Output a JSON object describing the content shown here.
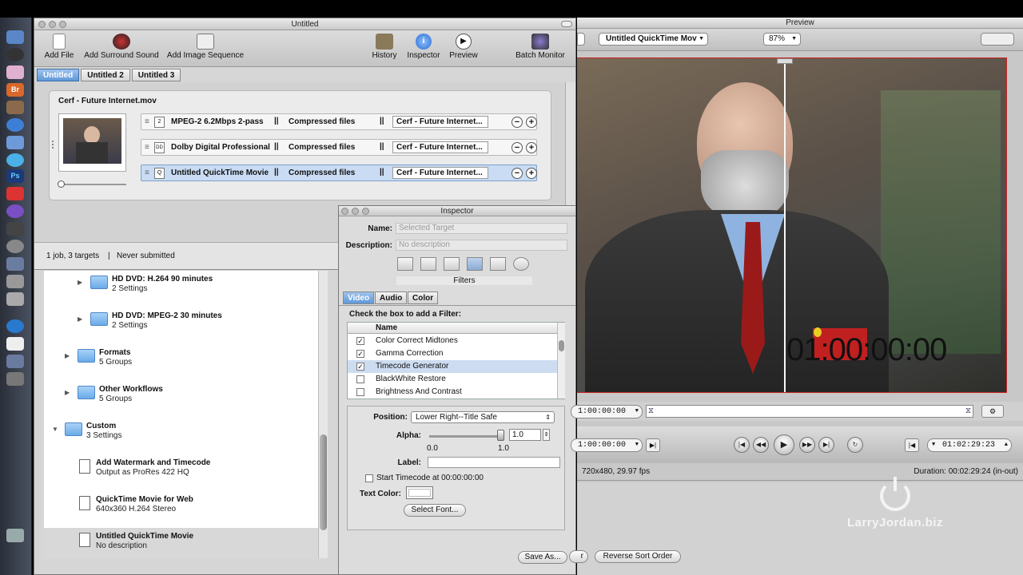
{
  "compressor": {
    "title": "Untitled",
    "toolbar": {
      "add_file": "Add File",
      "add_surround": "Add Surround Sound",
      "add_image_seq": "Add Image Sequence",
      "history": "History",
      "inspector": "Inspector",
      "preview": "Preview",
      "batch_monitor": "Batch Monitor"
    },
    "tabs": [
      "Untitled",
      "Untitled 2",
      "Untitled 3"
    ],
    "job": {
      "source": "Cerf - Future Internet.mov",
      "targets": [
        {
          "format": "MPEG-2 6.2Mbps 2-pass",
          "destination": "Compressed files",
          "output": "Cerf - Future Internet..."
        },
        {
          "format": "Dolby Digital Professional",
          "destination": "Compressed files",
          "output": "Cerf - Future Internet..."
        },
        {
          "format": "Untitled QuickTime Movie",
          "destination": "Compressed files",
          "output": "Cerf - Future Internet..."
        }
      ]
    },
    "status": {
      "jobs": "1 job, 3 targets",
      "submitted": "Never submitted"
    },
    "settings": [
      {
        "name": "HD DVD: H.264 90 minutes",
        "sub": "2 Settings"
      },
      {
        "name": "HD DVD: MPEG-2 30 minutes",
        "sub": "2 Settings"
      },
      {
        "name": "Formats",
        "sub": "5 Groups"
      },
      {
        "name": "Other Workflows",
        "sub": "5 Groups"
      },
      {
        "name": "Custom",
        "sub": "3 Settings"
      },
      {
        "name": "Add Watermark and Timecode",
        "sub": "Output as ProRes 422 HQ"
      },
      {
        "name": "QuickTime Movie for Web",
        "sub": "640x360 H.264 Stereo"
      },
      {
        "name": "Untitled QuickTime Movie",
        "sub": "No description"
      }
    ]
  },
  "inspector": {
    "title": "Inspector",
    "name_label": "Name:",
    "name_value": "Selected Target",
    "desc_label": "Description:",
    "desc_value": "No description",
    "pane_label": "Filters",
    "tabs": [
      "Video",
      "Audio",
      "Color"
    ],
    "instruction": "Check the box to add a Filter:",
    "col_name": "Name",
    "filters": [
      {
        "name": "Color Correct Midtones",
        "checked": "✓"
      },
      {
        "name": "Gamma Correction",
        "checked": "✓"
      },
      {
        "name": "Timecode Generator",
        "checked": "✓"
      },
      {
        "name": "BlackWhite Restore",
        "checked": ""
      },
      {
        "name": "Brightness And Contrast",
        "checked": ""
      }
    ],
    "position_label": "Position:",
    "position_value": "Lower Right--Title Safe",
    "alpha_label": "Alpha:",
    "alpha_value": "1.0",
    "alpha_min": "0.0",
    "alpha_max": "1.0",
    "label_label": "Label:",
    "start_tc": "Start Timecode at 00:00:00:00",
    "text_color_label": "Text Color:",
    "select_font": "Select Font...",
    "save_as": "Save As..."
  },
  "preview": {
    "title": "Preview",
    "source_menu": "Untitled QuickTime Mov",
    "zoom": "87%",
    "overlay_timecode": "01:00:00:00",
    "tc_in": "1:00:00:00",
    "tc_current": "1:00:00:00",
    "tc_out": "01:02:29:23",
    "format_info": "720x480, 29.97 fps",
    "duration": "Duration: 00:02:29:24 (in-out)",
    "reverse_sort": "Reverse Sort Order",
    "watermark": "LarryJordan.biz"
  },
  "dock": {
    "icons": [
      "finder-icon",
      "dashboard-icon",
      "itunes-icon",
      "bridge-icon",
      "photos-icon",
      "safari-icon",
      "mail-icon",
      "ichat-icon",
      "photoshop-icon",
      "calendar-icon",
      "motion-icon",
      "clapper-icon",
      "dvd-icon",
      "fcp-icon",
      "compressor-icon",
      "soundtrack-icon",
      "itunes2-icon",
      "notes-icon",
      "preview-icon",
      "app-icon",
      "trash-icon"
    ],
    "labels": {
      "bridge": "Br",
      "photoshop": "Ps"
    }
  }
}
